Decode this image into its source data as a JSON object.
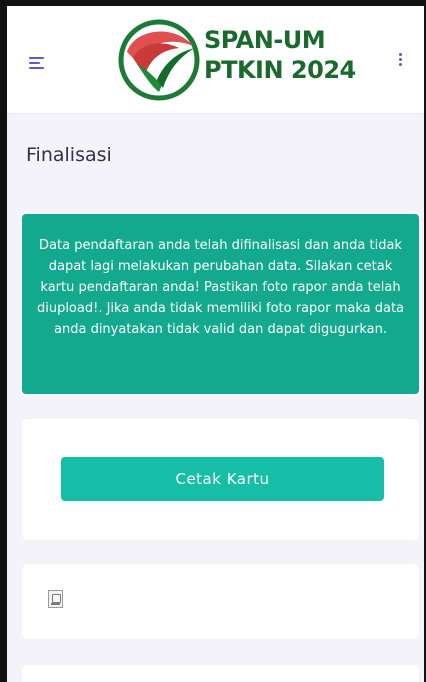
{
  "header": {
    "menu_icon": "hamburger-menu-icon",
    "more_icon": "kebab-vertical-icon",
    "logo_line1": "SPAN-UM",
    "logo_line2": "PTKIN 2024"
  },
  "page": {
    "title": "Finalisasi"
  },
  "alert": {
    "text": "Data pendaftaran anda telah difinalisasi dan anda tidak dapat lagi melakukan perubahan data. Silakan cetak kartu pendaftaran anda! Pastikan foto rapor anda telah diupload!. Jika anda tidak memiliki foto rapor maka data anda dinyatakan tidak valid dan dapat digugurkan.",
    "color": "#12a98e"
  },
  "actions": {
    "print_card_label": "Cetak Kartu",
    "button_color": "#16bea7"
  },
  "rapor": {
    "image_icon": "broken-image-icon"
  }
}
